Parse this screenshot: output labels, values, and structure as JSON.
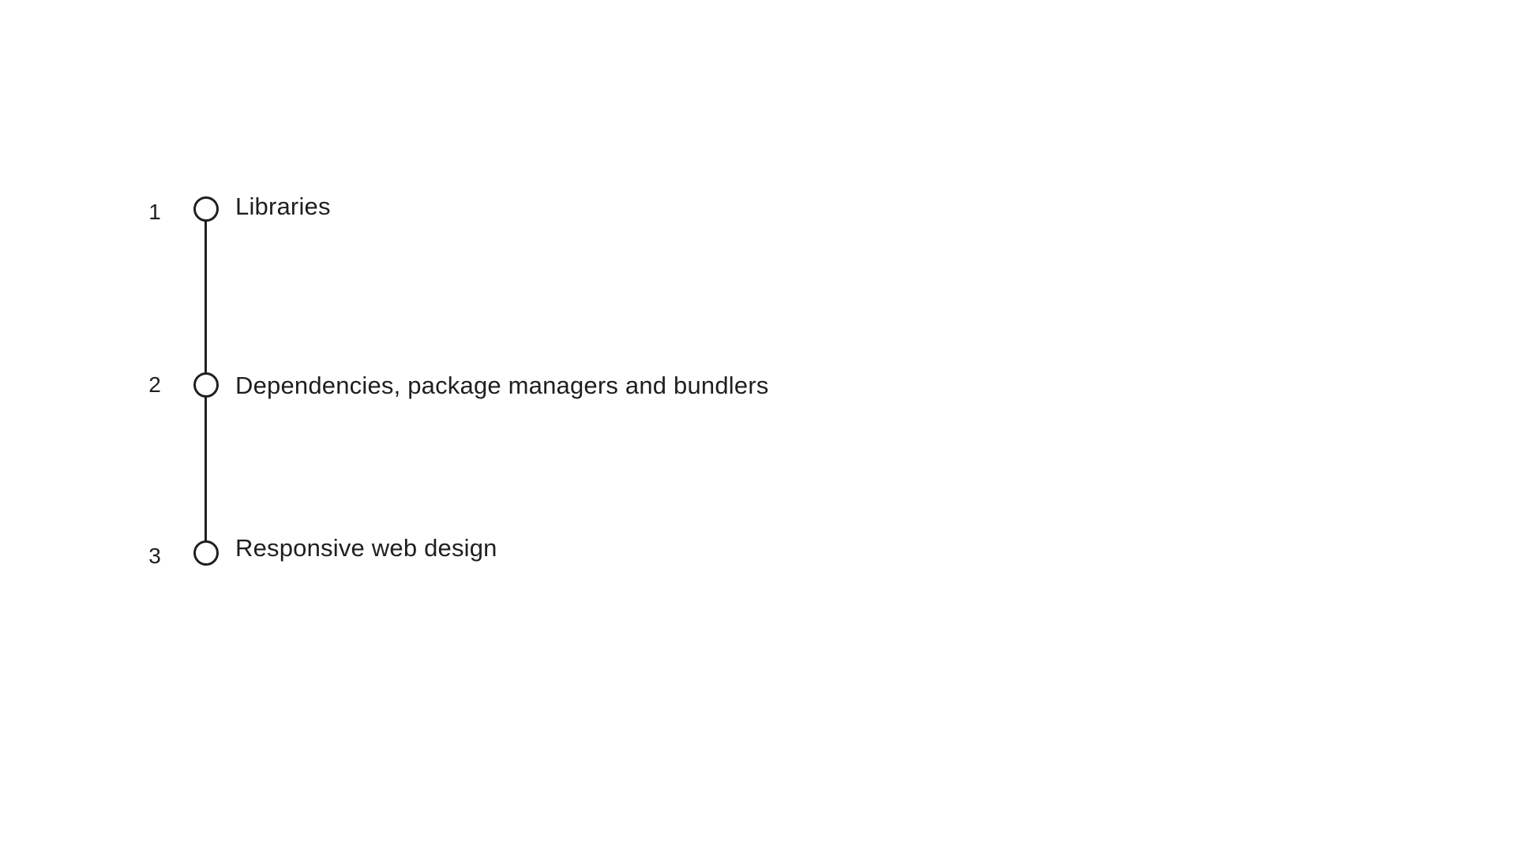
{
  "steps": [
    {
      "number": "1",
      "label": "Libraries"
    },
    {
      "number": "2",
      "label": "Dependencies, package managers and bundlers"
    },
    {
      "number": "3",
      "label": "Responsive web design"
    }
  ],
  "colors": {
    "background": "#ffffff",
    "ink": "#1f1f1f"
  }
}
